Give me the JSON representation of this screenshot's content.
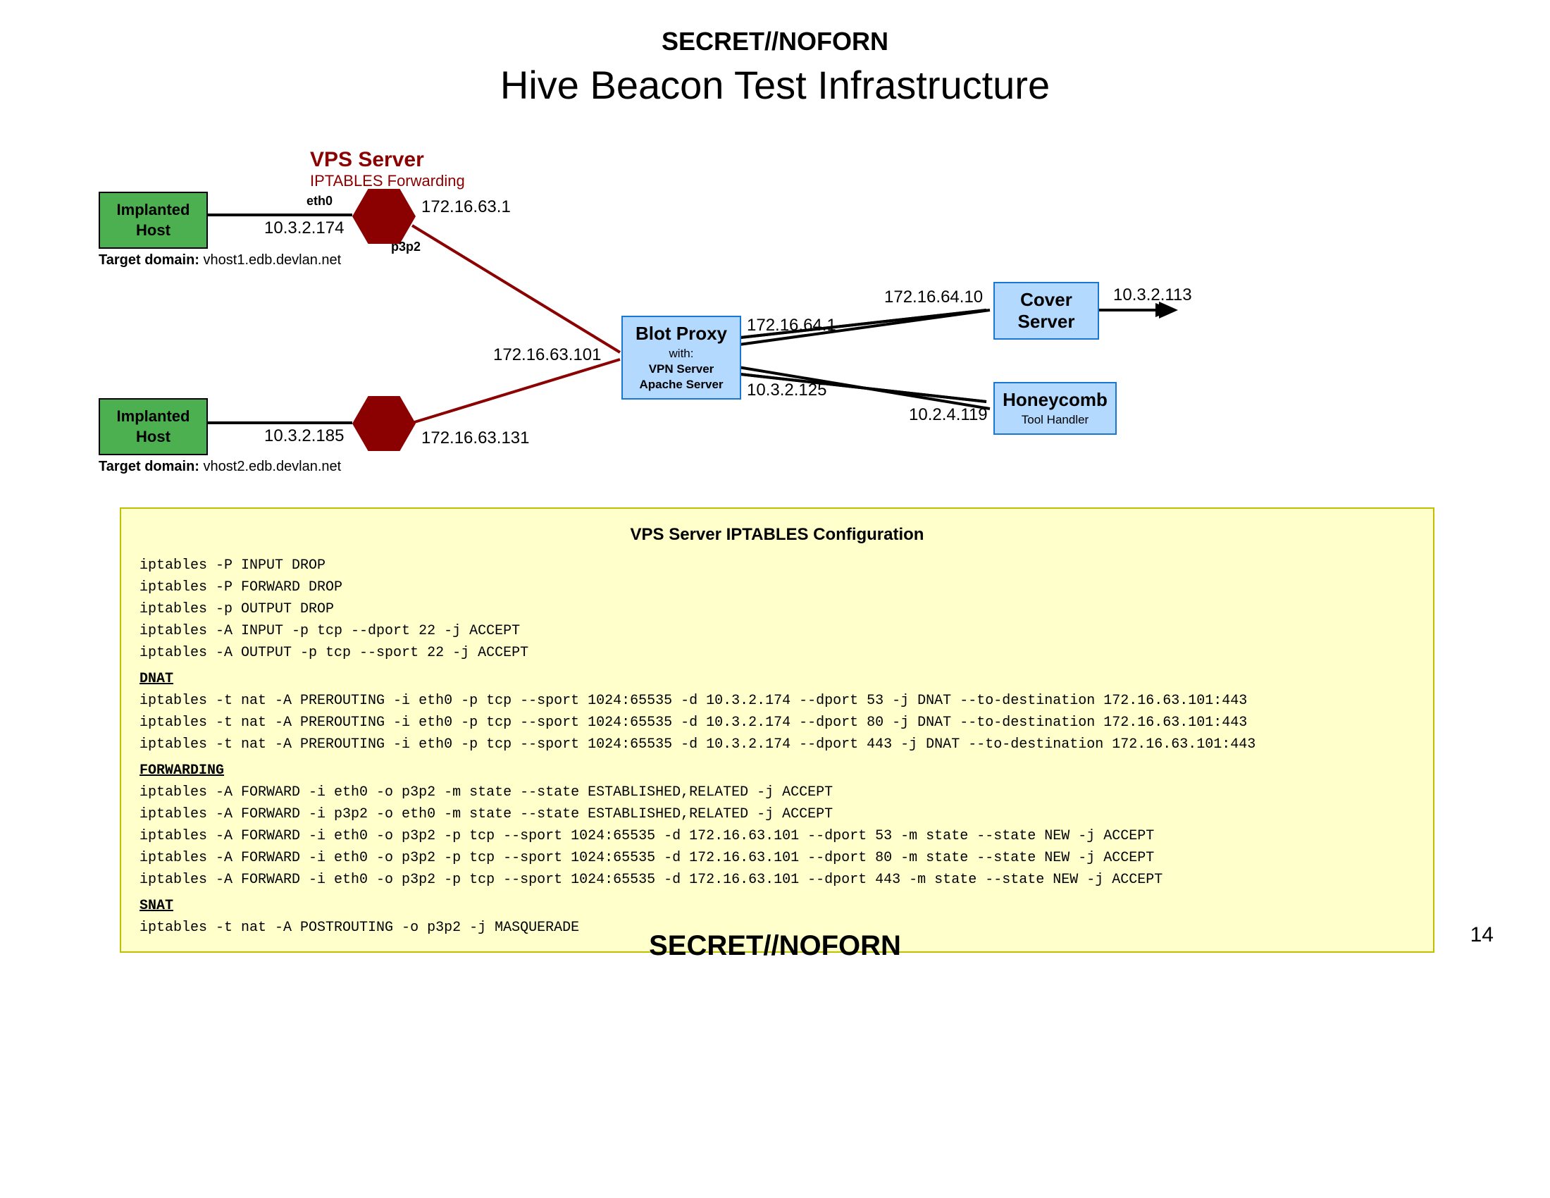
{
  "classification": "SECRET//NOFORN",
  "title": "Hive Beacon Test Infrastructure",
  "page_number": "14",
  "vps": {
    "title": "VPS Server",
    "subtitle": "IPTABLES Forwarding",
    "if_eth0": "eth0",
    "if_p3p2": "p3p2"
  },
  "host1": {
    "label": "Implanted\nHost",
    "ip_left": "10.3.2.174",
    "ip_right": "172.16.63.1",
    "domain_label": "Target domain:",
    "domain": "vhost1.edb.devlan.net"
  },
  "host2": {
    "label": "Implanted\nHost",
    "ip_left": "10.3.2.185",
    "ip_right": "172.16.63.131",
    "domain_label": "Target domain:",
    "domain": "vhost2.edb.devlan.net"
  },
  "blot": {
    "title": "Blot Proxy",
    "with": "with:",
    "line1": "VPN Server",
    "line2": "Apache Server",
    "ip_left": "172.16.63.101",
    "ip_top_right": "172.16.64.1",
    "ip_bot_right": "10.3.2.125"
  },
  "cover": {
    "title": "Cover\nServer",
    "ip_left": "172.16.64.10",
    "ip_right": "10.3.2.113"
  },
  "honeycomb": {
    "title": "Honeycomb",
    "sub": "Tool Handler",
    "ip_left": "10.2.4.119"
  },
  "config": {
    "title": "VPS Server IPTABLES Configuration",
    "base": [
      "iptables -P INPUT DROP",
      "iptables -P FORWARD DROP",
      "iptables -p OUTPUT DROP",
      "iptables -A INPUT -p tcp --dport 22 -j ACCEPT",
      "iptables -A OUTPUT -p tcp --sport 22 -j ACCEPT"
    ],
    "dnat_hdr": "DNAT",
    "dnat": [
      "iptables -t nat -A PREROUTING -i eth0 -p tcp --sport 1024:65535 -d 10.3.2.174 --dport 53 -j DNAT --to-destination 172.16.63.101:443",
      "iptables -t nat -A PREROUTING -i eth0 -p tcp --sport 1024:65535 -d 10.3.2.174 --dport 80 -j DNAT --to-destination 172.16.63.101:443",
      "iptables -t nat -A PREROUTING -i eth0 -p tcp --sport 1024:65535 -d 10.3.2.174 --dport 443 -j DNAT --to-destination 172.16.63.101:443"
    ],
    "fwd_hdr": "FORWARDING",
    "fwd": [
      "iptables -A FORWARD -i eth0 -o p3p2 -m state --state ESTABLISHED,RELATED -j ACCEPT",
      "iptables -A FORWARD -i p3p2 -o eth0 -m state --state ESTABLISHED,RELATED -j ACCEPT",
      "iptables -A FORWARD -i eth0 -o p3p2 -p tcp --sport 1024:65535 -d 172.16.63.101 --dport 53 -m state --state NEW -j ACCEPT",
      "iptables -A FORWARD -i eth0 -o p3p2 -p tcp --sport 1024:65535 -d 172.16.63.101 --dport 80 -m state --state NEW -j ACCEPT",
      "iptables -A FORWARD -i eth0 -o p3p2 -p tcp --sport 1024:65535 -d 172.16.63.101 --dport 443 -m state --state NEW -j ACCEPT"
    ],
    "snat_hdr": "SNAT",
    "snat": [
      "iptables -t nat -A POSTROUTING -o p3p2 -j MASQUERADE"
    ]
  }
}
